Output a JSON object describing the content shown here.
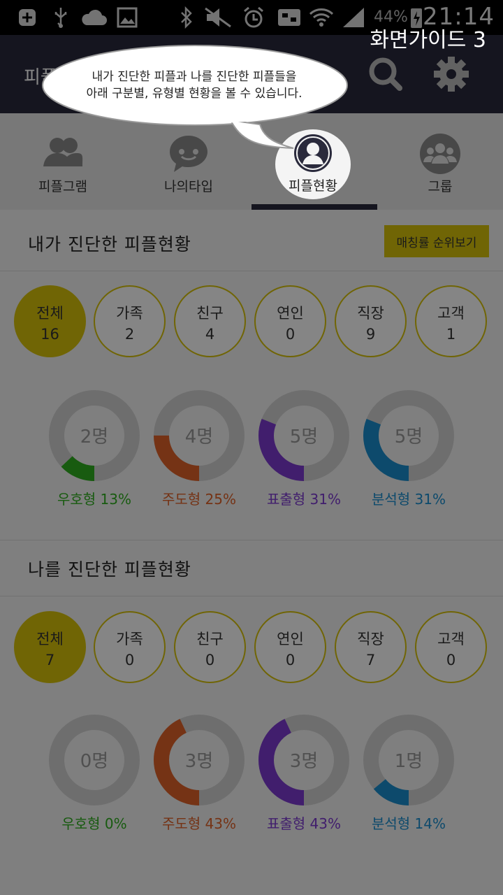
{
  "status_bar": {
    "time": "21:14",
    "battery_pct": "44%"
  },
  "header": {
    "title": "피플"
  },
  "tabs": [
    {
      "label": "피플그램",
      "icon": "people-icon"
    },
    {
      "label": "나의타입",
      "icon": "chat-bubble-icon"
    },
    {
      "label": "피플현황",
      "icon": "person-circle-icon",
      "active": true
    },
    {
      "label": "그룹",
      "icon": "group-icon"
    }
  ],
  "guide": {
    "label": "화면가이드 3",
    "bubble_line1": "내가 진단한 피플과 나를 진단한 피플들을",
    "bubble_line2": "아래 구분별, 유형별 현황을 볼 수 있습니다."
  },
  "my_diagnosed": {
    "title": "내가 진단한 피플현황",
    "rank_button": "매칭률 순위보기",
    "categories": [
      {
        "name": "전체",
        "count": "16",
        "active": true
      },
      {
        "name": "가족",
        "count": "2"
      },
      {
        "name": "친구",
        "count": "4"
      },
      {
        "name": "연인",
        "count": "0"
      },
      {
        "name": "직장",
        "count": "9"
      },
      {
        "name": "고객",
        "count": "1"
      }
    ],
    "types": [
      {
        "count": "2명",
        "label": "우호형 13%",
        "percent": 13,
        "color": "#2fae1f"
      },
      {
        "count": "4명",
        "label": "주도형 25%",
        "percent": 25,
        "color": "#e0622a"
      },
      {
        "count": "5명",
        "label": "표출형 31%",
        "percent": 31,
        "color": "#7e3bd1"
      },
      {
        "count": "5명",
        "label": "분석형 31%",
        "percent": 31,
        "color": "#1a8fd0"
      }
    ]
  },
  "diagnosed_me": {
    "title": "나를 진단한 피플현황",
    "categories": [
      {
        "name": "전체",
        "count": "7",
        "active": true
      },
      {
        "name": "가족",
        "count": "0"
      },
      {
        "name": "친구",
        "count": "0"
      },
      {
        "name": "연인",
        "count": "0"
      },
      {
        "name": "직장",
        "count": "7"
      },
      {
        "name": "고객",
        "count": "0"
      }
    ],
    "types": [
      {
        "count": "0명",
        "label": "우호형 0%",
        "percent": 0,
        "color": "#2fae1f"
      },
      {
        "count": "3명",
        "label": "주도형 43%",
        "percent": 43,
        "color": "#e0622a"
      },
      {
        "count": "3명",
        "label": "표출형 43%",
        "percent": 43,
        "color": "#7e3bd1"
      },
      {
        "count": "1명",
        "label": "분석형 14%",
        "percent": 14,
        "color": "#1a8fd0"
      }
    ]
  },
  "colors": {
    "accent": "#d7c20a",
    "header_bg": "#2a2a3c",
    "ring_bg": "#d4d4d4"
  }
}
